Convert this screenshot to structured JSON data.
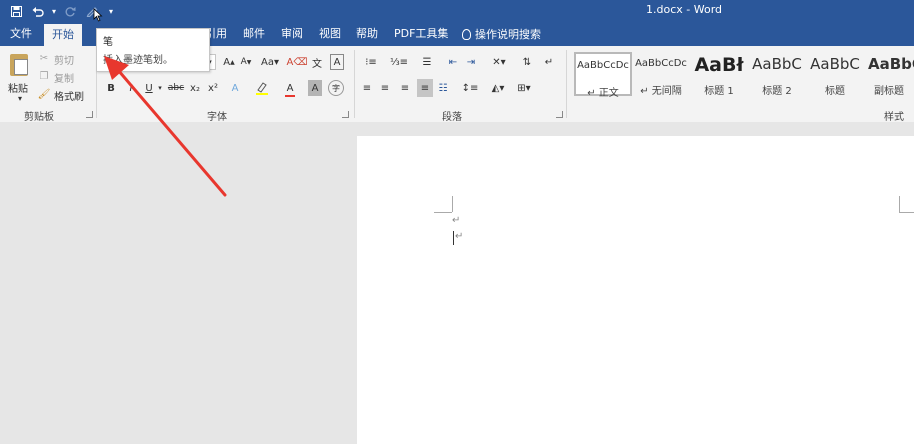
{
  "title_bar": {
    "document_title": "1.docx  -  Word",
    "qat_icons": [
      "save-icon",
      "undo-icon",
      "redo-icon",
      "pen-icon",
      "customize-icon"
    ]
  },
  "tabs": [
    {
      "label": "文件"
    },
    {
      "label": "开始"
    },
    {
      "label": "引用"
    },
    {
      "label": "邮件"
    },
    {
      "label": "审阅"
    },
    {
      "label": "视图"
    },
    {
      "label": "帮助"
    },
    {
      "label": "PDF工具集"
    }
  ],
  "tell_me": "操作说明搜索",
  "clipboard": {
    "paste": "粘贴",
    "cut": "剪切",
    "copy": "复制",
    "format_painter": "格式刷",
    "group": "剪贴板"
  },
  "font": {
    "group": "字体",
    "buttons": [
      "B",
      "I",
      "U",
      "abc",
      "x₂",
      "x²",
      "A",
      "A",
      "Aa"
    ]
  },
  "paragraph": {
    "group": "段落"
  },
  "styles": {
    "group": "样式",
    "items": [
      {
        "sample": "AaBbCcDc",
        "name": "↵ 正文"
      },
      {
        "sample": "AaBbCcDc",
        "name": "↵ 无间隔"
      },
      {
        "sample": "AaBł",
        "name": "标题 1"
      },
      {
        "sample": "AaBbC",
        "name": "标题 2"
      },
      {
        "sample": "AaBbC",
        "name": "标题"
      },
      {
        "sample": "AaBbC",
        "name": "副标题"
      }
    ]
  },
  "tooltip": {
    "title": "笔",
    "description": "插入墨迹笔划。"
  },
  "document": {
    "paragraph_marks": [
      "↵",
      "↵"
    ]
  },
  "colors": {
    "brand_blue": "#2b579a",
    "arrow_red": "#e8372e"
  }
}
